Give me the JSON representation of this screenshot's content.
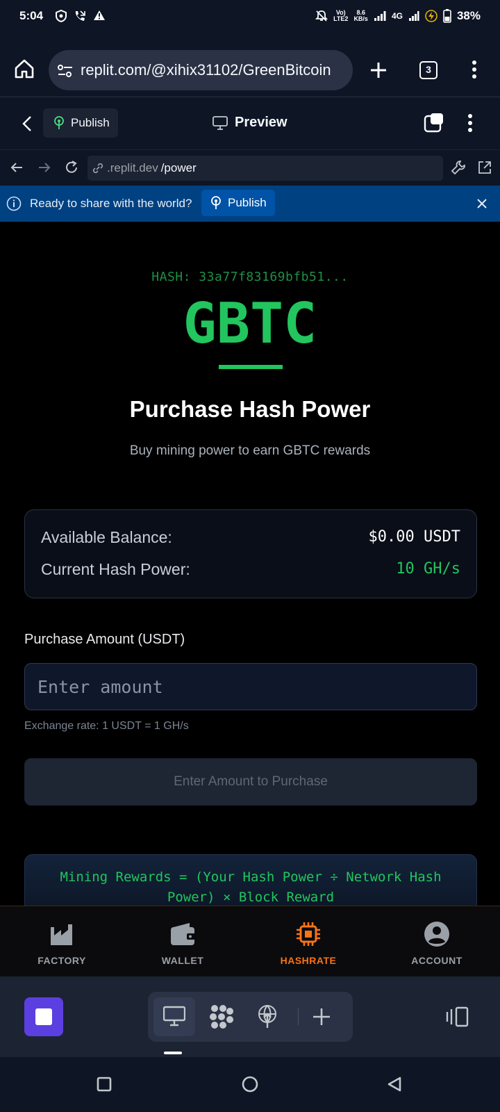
{
  "status_bar": {
    "time": "5:04",
    "net_top": "Vo)",
    "net_bottom": "LTE2",
    "speed_top": "8.6",
    "speed_bottom": "KB/s",
    "network": "4G",
    "battery": "38%"
  },
  "browser": {
    "url": "replit.com/@xihix31102/GreenBitcoin",
    "tab_count": "3"
  },
  "replit_header": {
    "publish_label": "Publish",
    "preview_label": "Preview"
  },
  "devtools": {
    "url_prefix": ".replit.dev",
    "url_path": "/power"
  },
  "banner": {
    "text": "Ready to share with the world?",
    "publish_label": "Publish"
  },
  "app": {
    "hash_line": "HASH: 33a77f83169bfb51...",
    "logo": "GBTC",
    "title": "Purchase Hash Power",
    "subtitle": "Buy mining power to earn GBTC rewards",
    "balance_label": "Available Balance:",
    "balance_value": "$0.00 USDT",
    "hash_power_label": "Current Hash Power:",
    "hash_power_value": "10 GH/s",
    "amount_label": "Purchase Amount (USDT)",
    "amount_placeholder": "Enter amount",
    "exchange_rate": "Exchange rate: 1 USDT = 1 GH/s",
    "purchase_button": "Enter Amount to Purchase",
    "rewards_formula": "Mining Rewards = (Your Hash Power ÷ Network Hash Power) × Block Reward"
  },
  "nav": {
    "items": [
      {
        "label": "FACTORY",
        "icon": "factory-icon"
      },
      {
        "label": "WALLET",
        "icon": "wallet-icon"
      },
      {
        "label": "HASHRATE",
        "icon": "chip-icon",
        "active": true
      },
      {
        "label": "ACCOUNT",
        "icon": "account-icon"
      }
    ]
  },
  "colors": {
    "accent_green": "#22c55e",
    "active_orange": "#f97316",
    "banner_blue": "#004182",
    "replit_purple": "#5c3fe0"
  }
}
